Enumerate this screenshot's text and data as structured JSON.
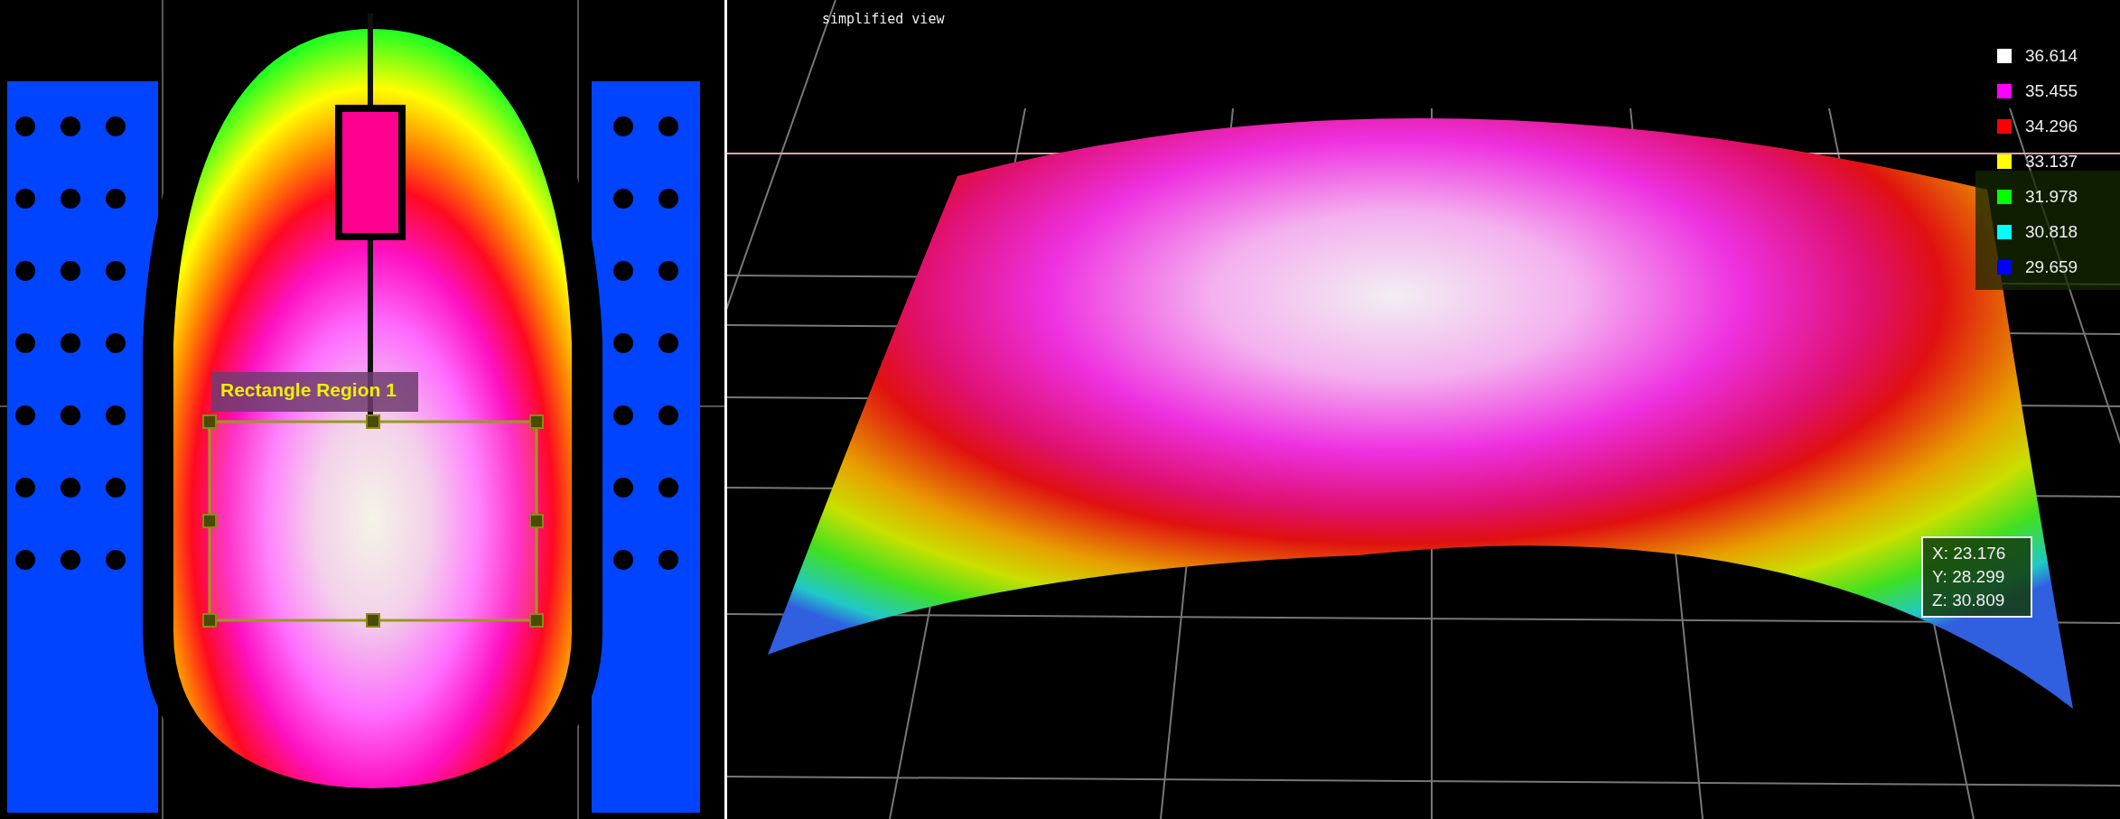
{
  "scan_view": {
    "region_label": "Rectangle Region 1"
  },
  "surface_view": {
    "title": "simplified view",
    "legend": [
      {
        "value": "36.614",
        "color": "#ffffff"
      },
      {
        "value": "35.455",
        "color": "#ff00ff"
      },
      {
        "value": "34.296",
        "color": "#ff0000"
      },
      {
        "value": "33.137",
        "color": "#ffff00"
      },
      {
        "value": "31.978",
        "color": "#00ff00"
      },
      {
        "value": "30.818",
        "color": "#00ffff"
      },
      {
        "value": "29.659",
        "color": "#0000ff"
      }
    ],
    "probe": [
      "X: 23.176",
      "Y: 28.299",
      "Z: 30.809"
    ]
  }
}
